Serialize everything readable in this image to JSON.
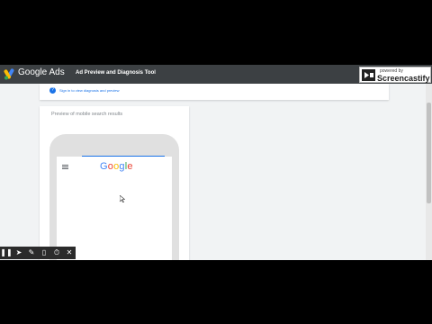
{
  "header": {
    "brand": "Google Ads",
    "tool_title": "Ad Preview and Diagnosis Tool"
  },
  "overlay": {
    "powered_by": "powered by",
    "name": "Screencastify"
  },
  "signin": {
    "text": "Sign in to view diagnosis and preview",
    "icon": "info-icon"
  },
  "preview": {
    "label": "Preview of mobile search results",
    "logo": [
      "G",
      "o",
      "o",
      "g",
      "l",
      "e"
    ],
    "logo_colors": [
      "#4285f4",
      "#ea4335",
      "#fbbc05",
      "#4285f4",
      "#34a853",
      "#ea4335"
    ]
  },
  "recorder_toolbar": {
    "icons": [
      "pause-icon",
      "cursor-icon",
      "pen-icon",
      "eraser-icon",
      "timer-icon",
      "close-icon"
    ]
  },
  "colors": {
    "topbar": "#3c4043",
    "accent": "#1a73e8",
    "background": "#f1f3f4"
  }
}
